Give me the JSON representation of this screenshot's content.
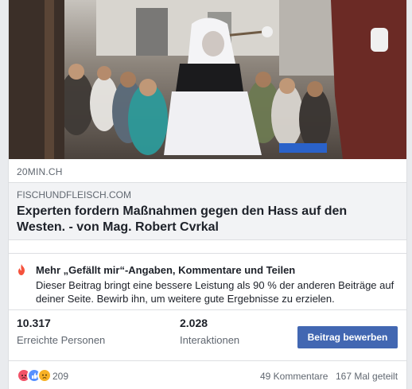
{
  "post": {
    "source_label": "20MIN.CH",
    "link": {
      "domain": "FISCHUNDFLEISCH.COM",
      "headline": "Experten fordern Maßnahmen gegen den Hass auf den Westen. - von Mag. Robert Cvrkal"
    }
  },
  "insight": {
    "icon": "flame-icon",
    "title": "Mehr „Gefällt mir“-Angaben, Kommentare und Teilen",
    "body": "Dieser Beitrag bringt eine bessere Leistung als 90 % der anderen Beiträge auf deiner Seite. Bewirb ihn, um weitere gute Ergebnisse zu erzielen."
  },
  "stats": {
    "reach_value": "10.317",
    "reach_label": "Erreichte Personen",
    "engagement_value": "2.028",
    "engagement_label": "Interaktionen",
    "boost_label": "Beitrag bewerben"
  },
  "footer": {
    "reactions": [
      "angry",
      "like",
      "sad"
    ],
    "reaction_count": "209",
    "comments": "49 Kommentare",
    "shares": "167 Mal geteilt"
  },
  "colors": {
    "boost_button": "#4267b2",
    "flame": "#f5533d",
    "muted_text": "#606770"
  }
}
